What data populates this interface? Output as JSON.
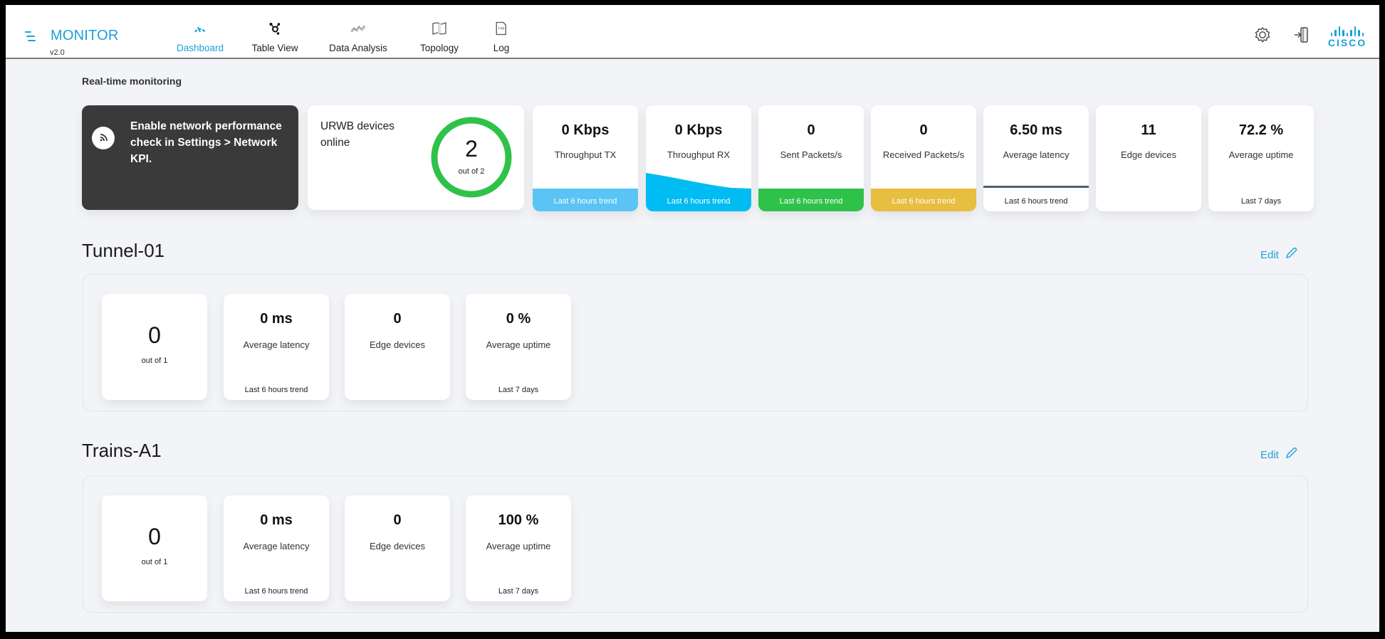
{
  "app": {
    "title": "MONITOR",
    "version": "v2.0",
    "brand_color": "#1aa1d8",
    "logo_text": "CISCO"
  },
  "nav": {
    "items": [
      {
        "label": "Dashboard",
        "icon": "gauge-icon",
        "active": true
      },
      {
        "label": "Table View",
        "icon": "network-node-icon",
        "active": false
      },
      {
        "label": "Data Analysis",
        "icon": "trend-line-icon",
        "active": false
      },
      {
        "label": "Topology",
        "icon": "map-icon",
        "active": false
      },
      {
        "label": "Log",
        "icon": "log-file-icon",
        "active": false
      }
    ]
  },
  "header_actions": {
    "settings_icon": "gear-icon",
    "logout_icon": "logout-icon"
  },
  "realtime": {
    "section_label": "Real-time monitoring",
    "notice": {
      "text": "Enable network performance check in Settings > Network KPI.",
      "icon": "wifi-signal-icon"
    },
    "devices_online": {
      "title": "URWB devices online",
      "value": "2",
      "subtitle": "out of 2",
      "online": 2,
      "total": 2,
      "ring_color": "#2fc24a"
    },
    "kpis": [
      {
        "value": "0 Kbps",
        "label": "Throughput TX",
        "footer": "Last 6 hours trend",
        "trend_color": "#5ac4f5",
        "trend": "flat"
      },
      {
        "value": "0 Kbps",
        "label": "Throughput RX",
        "footer": "Last 6 hours trend",
        "trend_color": "#00bcf2",
        "trend": "declining"
      },
      {
        "value": "0",
        "label": "Sent Packets/s",
        "footer": "Last 6 hours trend",
        "trend_color": "#2fc24a",
        "trend": "flat"
      },
      {
        "value": "0",
        "label": "Received Packets/s",
        "footer": "Last 6 hours trend",
        "trend_color": "#e6be40",
        "trend": "flat"
      },
      {
        "value": "6.50 ms",
        "label": "Average latency",
        "footer": "Last 6 hours trend",
        "trend_color": "#4b5f6e",
        "trend": "line"
      },
      {
        "value": "11",
        "label": "Edge devices",
        "footer": "",
        "trend_color": "",
        "trend": "none"
      },
      {
        "value": "72.2 %",
        "label": "Average uptime",
        "footer": "Last 7 days",
        "trend_color": "",
        "trend": "none"
      }
    ]
  },
  "groups": [
    {
      "name": "Tunnel-01",
      "edit_label": "Edit",
      "devices": {
        "value": "0",
        "subtitle": "out of 1"
      },
      "kpis": [
        {
          "value": "0 ms",
          "label": "Average latency",
          "footer": "Last 6 hours trend"
        },
        {
          "value": "0",
          "label": "Edge devices",
          "footer": ""
        },
        {
          "value": "0 %",
          "label": "Average uptime",
          "footer": "Last 7 days"
        }
      ]
    },
    {
      "name": "Trains-A1",
      "edit_label": "Edit",
      "devices": {
        "value": "0",
        "subtitle": "out of 1"
      },
      "kpis": [
        {
          "value": "0 ms",
          "label": "Average latency",
          "footer": "Last 6 hours trend"
        },
        {
          "value": "0",
          "label": "Edge devices",
          "footer": ""
        },
        {
          "value": "100 %",
          "label": "Average uptime",
          "footer": "Last 7 days"
        }
      ]
    }
  ]
}
